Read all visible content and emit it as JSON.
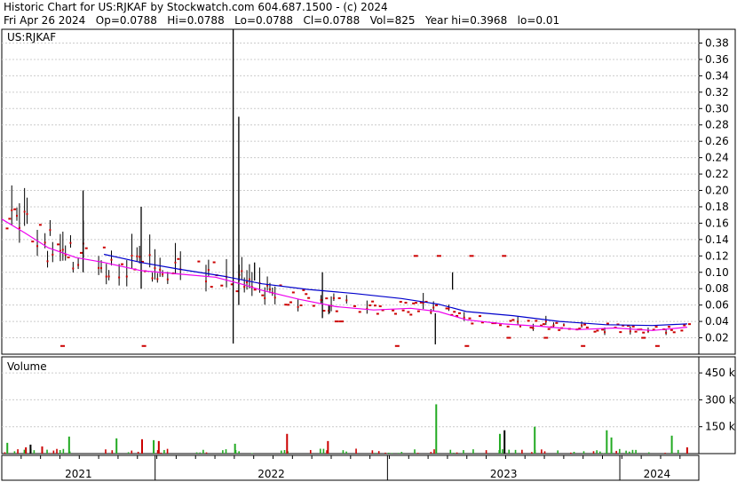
{
  "header": {
    "line1": "Historic Chart for US:RJKAF by Stockwatch.com 604.687.1500 - (c) 2024",
    "line2": "Fri Apr 26 2024   Op=0.0788   Hi=0.0788   Lo=0.0788   Cl=0.0788   Vol=825   Year hi=0.3968   lo=0.01"
  },
  "chart_data": [
    {
      "type": "price",
      "title": "US:RJKAF",
      "y_ticks": [
        "0.02",
        "0.04",
        "0.06",
        "0.08",
        "0.10",
        "0.12",
        "0.14",
        "0.16",
        "0.18",
        "0.20",
        "0.22",
        "0.24",
        "0.26",
        "0.28",
        "0.30",
        "0.32",
        "0.34",
        "0.36",
        "0.38"
      ],
      "ylim": [
        0,
        0.3968
      ],
      "x_labels": [
        "2021",
        "2022",
        "2023",
        "2024"
      ],
      "colors": {
        "bars": "#000000",
        "flat_marks": "#cc0000",
        "ma_short": "#ee00ee",
        "ma_long": "#0000cc",
        "grid": "#cccccc"
      },
      "spikes": [
        {
          "t": 49.8,
          "low": 0.013,
          "high": 0.3968
        },
        {
          "t": 51.0,
          "low": 0.06,
          "high": 0.29
        },
        {
          "t": 17.5,
          "low": 0.1,
          "high": 0.2
        },
        {
          "t": 30.0,
          "low": 0.08,
          "high": 0.18
        },
        {
          "t": 54.4,
          "low": 0.09,
          "high": 0.112
        },
        {
          "t": 69.0,
          "low": 0.044,
          "high": 0.1
        },
        {
          "t": 70.5,
          "low": 0.05,
          "high": 0.06
        },
        {
          "t": 93.3,
          "low": 0.012,
          "high": 0.05
        },
        {
          "t": 97.0,
          "low": 0.0788,
          "high": 0.1
        }
      ],
      "ma_long": [
        [
          22.0,
          0.122
        ],
        [
          30,
          0.112
        ],
        [
          38,
          0.104
        ],
        [
          48,
          0.095
        ],
        [
          56,
          0.086
        ],
        [
          66,
          0.079
        ],
        [
          76,
          0.074
        ],
        [
          86,
          0.068
        ],
        [
          94,
          0.061
        ],
        [
          100,
          0.052
        ],
        [
          110,
          0.047
        ],
        [
          120,
          0.04
        ],
        [
          130,
          0.036
        ],
        [
          140,
          0.035
        ],
        [
          147.5,
          0.037
        ]
      ],
      "ma_short": [
        [
          0,
          0.165
        ],
        [
          5,
          0.148
        ],
        [
          10,
          0.13
        ],
        [
          16,
          0.118
        ],
        [
          22,
          0.112
        ],
        [
          30,
          0.102
        ],
        [
          38,
          0.098
        ],
        [
          46,
          0.094
        ],
        [
          52,
          0.085
        ],
        [
          56,
          0.078
        ],
        [
          64,
          0.067
        ],
        [
          72,
          0.058
        ],
        [
          80,
          0.054
        ],
        [
          88,
          0.056
        ],
        [
          94,
          0.052
        ],
        [
          100,
          0.042
        ],
        [
          108,
          0.037
        ],
        [
          116,
          0.034
        ],
        [
          124,
          0.03
        ],
        [
          132,
          0.032
        ],
        [
          140,
          0.029
        ],
        [
          147.5,
          0.033
        ]
      ],
      "x_range": [
        0,
        150
      ]
    },
    {
      "type": "bar",
      "title": "Volume",
      "y_ticks": [
        "150 k",
        "300 k",
        "450 k"
      ],
      "ylim": [
        0,
        500000
      ],
      "colors": {
        "up": "#22aa22",
        "down": "#cc0000",
        "neutral": "#000000"
      },
      "bars": [
        {
          "t": 1.0,
          "v": 60000,
          "c": "up"
        },
        {
          "t": 5.0,
          "v": 35000,
          "c": "down"
        },
        {
          "t": 6.0,
          "v": 50000,
          "c": "neutral"
        },
        {
          "t": 8.5,
          "v": 40000,
          "c": "down"
        },
        {
          "t": 14.3,
          "v": 95000,
          "c": "up"
        },
        {
          "t": 24.5,
          "v": 85000,
          "c": "up"
        },
        {
          "t": 30.0,
          "v": 80000,
          "c": "down"
        },
        {
          "t": 32.5,
          "v": 75000,
          "c": "up"
        },
        {
          "t": 33.6,
          "v": 70000,
          "c": "down"
        },
        {
          "t": 50.0,
          "v": 55000,
          "c": "up"
        },
        {
          "t": 61.2,
          "v": 110000,
          "c": "down"
        },
        {
          "t": 70.0,
          "v": 70000,
          "c": "down"
        },
        {
          "t": 93.3,
          "v": 275000,
          "c": "up"
        },
        {
          "t": 107.0,
          "v": 110000,
          "c": "up"
        },
        {
          "t": 108.0,
          "v": 130000,
          "c": "neutral"
        },
        {
          "t": 114.5,
          "v": 150000,
          "c": "up"
        },
        {
          "t": 130.0,
          "v": 130000,
          "c": "up"
        },
        {
          "t": 131.0,
          "v": 90000,
          "c": "up"
        },
        {
          "t": 144.0,
          "v": 100000,
          "c": "up"
        },
        {
          "t": 147.3,
          "v": 35000,
          "c": "down"
        }
      ]
    }
  ]
}
